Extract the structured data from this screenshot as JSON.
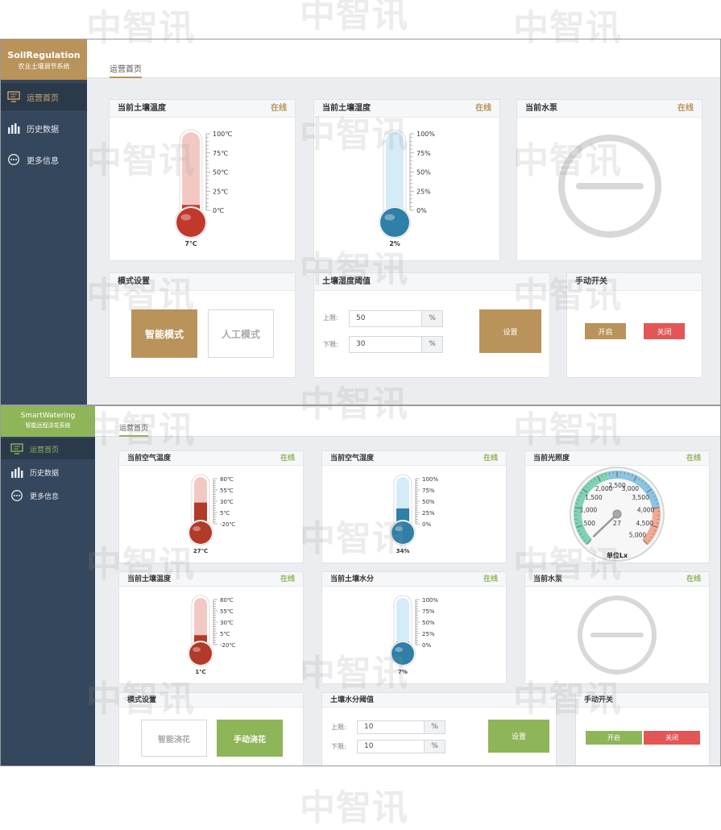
{
  "watermark": "中智讯",
  "soil_app": {
    "brand_en": "SoilRegulation",
    "brand_cn": "农业土壤调节系统",
    "accent": "#b9935a",
    "nav": [
      {
        "label": "运营首页",
        "icon": "monitor-icon"
      },
      {
        "label": "历史数据",
        "icon": "bar-chart-icon"
      },
      {
        "label": "更多信息",
        "icon": "more-icon"
      }
    ],
    "tab": "运营首页",
    "status_online": "在线",
    "cards": {
      "soil_temp": {
        "title": "当前土壤温度",
        "reading": "7℃",
        "ticks": [
          "100℃",
          "75℃",
          "50℃",
          "25℃",
          "0℃"
        ],
        "value": 7,
        "min": 0,
        "max": 100
      },
      "soil_humidity": {
        "title": "当前土壤湿度",
        "reading": "2%",
        "ticks": [
          "100%",
          "75%",
          "50%",
          "25%",
          "0%"
        ],
        "value": 2,
        "min": 0,
        "max": 100
      },
      "pump": {
        "title": "当前水泵",
        "icon": "pump-off-icon"
      }
    },
    "mode": {
      "title": "模式设置",
      "smart": "智能模式",
      "manual": "人工模式",
      "active": "smart"
    },
    "threshold": {
      "title": "土壤湿度阈值",
      "upper_label": "上限:",
      "lower_label": "下限:",
      "upper": "50",
      "lower": "30",
      "unit": "%",
      "set": "设置"
    },
    "switch": {
      "title": "手动开关",
      "on": "开启",
      "off": "关闭"
    }
  },
  "water_app": {
    "brand_en": "SmartWatering",
    "brand_cn": "智能远程浇花系统",
    "accent": "#8fb559",
    "nav": [
      {
        "label": "运营首页",
        "icon": "monitor-icon"
      },
      {
        "label": "历史数据",
        "icon": "bar-chart-icon"
      },
      {
        "label": "更多信息",
        "icon": "more-icon"
      }
    ],
    "tab": "运营首页",
    "status_online": "在线",
    "cards": {
      "air_temp": {
        "title": "当前空气温度",
        "reading": "27℃",
        "ticks": [
          "80℃",
          "55℃",
          "30℃",
          "5℃",
          "-20℃"
        ],
        "value": 27,
        "min": -20,
        "max": 80
      },
      "air_humidity": {
        "title": "当前空气湿度",
        "reading": "34%",
        "ticks": [
          "100%",
          "75%",
          "50%",
          "25%",
          "0%"
        ],
        "value": 34,
        "min": 0,
        "max": 100
      },
      "light": {
        "title": "当前光照度",
        "unit": "单位Lx",
        "reading": "27",
        "scale": [
          "500",
          "1,000",
          "1,500",
          "2,000",
          "2,500",
          "3,000",
          "3,500",
          "4,000",
          "4,500",
          "5,000"
        ],
        "value": 27,
        "min": 0,
        "max": 5000
      },
      "soil_temp": {
        "title": "当前土壤温度",
        "reading": "1℃",
        "ticks": [
          "80℃",
          "55℃",
          "30℃",
          "5℃",
          "-20℃"
        ],
        "value": 1,
        "min": -20,
        "max": 80
      },
      "soil_moisture": {
        "title": "当前土壤水分",
        "reading": "7%",
        "ticks": [
          "100%",
          "75%",
          "50%",
          "25%",
          "0%"
        ],
        "value": 7,
        "min": 0,
        "max": 100
      },
      "pump": {
        "title": "当前水泵",
        "icon": "pump-off-icon"
      }
    },
    "mode": {
      "title": "模式设置",
      "smart": "智能浇花",
      "manual": "手动浇花",
      "active": "manual"
    },
    "threshold": {
      "title": "土壤水分阈值",
      "upper_label": "上限:",
      "lower_label": "下限:",
      "upper": "10",
      "lower": "10",
      "unit": "%",
      "set": "设置"
    },
    "switch": {
      "title": "手动开关",
      "on": "开启",
      "off": "关闭"
    }
  }
}
